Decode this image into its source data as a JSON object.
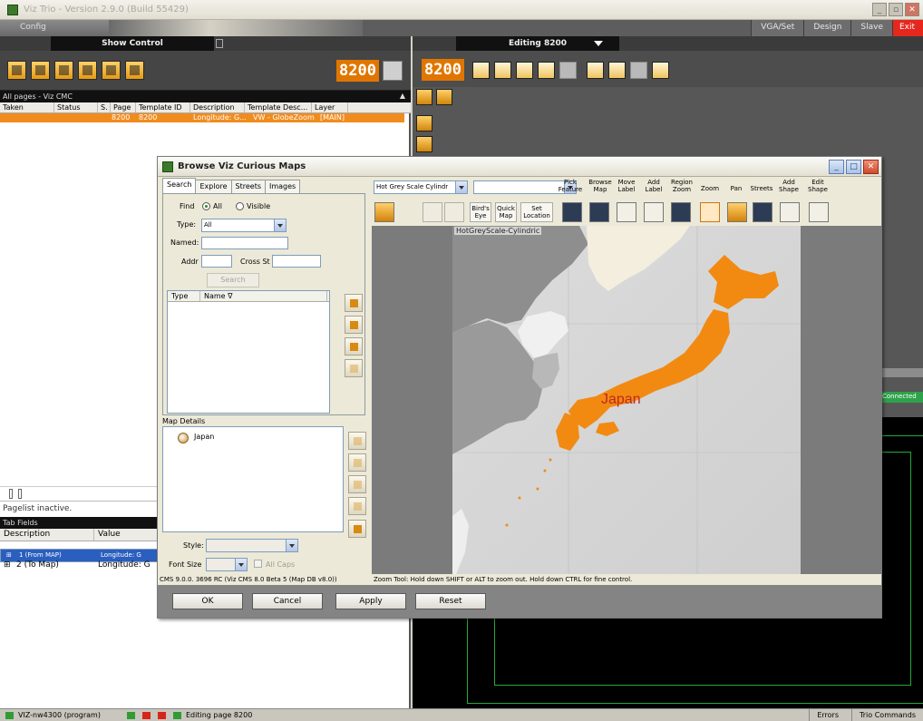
{
  "window": {
    "title": "Viz Trio - Version 2.9.0 (Build 55429)",
    "config_label": "Config",
    "right_tabs": [
      "VGA/Set",
      "Design",
      "Slave",
      "Exit"
    ]
  },
  "left_panel": {
    "header": "Show Control",
    "page_number": "8200",
    "pages_bar": "All pages - Viz CMC",
    "columns": [
      "Taken",
      "Status",
      "S.",
      "Page",
      "Template ID",
      "Description",
      "Template Desc...",
      "Layer"
    ],
    "row": {
      "page": "8200",
      "template_id": "8200",
      "description": "Longitude: G...",
      "template_desc": "VW - GlobeZoom",
      "layer": "[MAIN]"
    },
    "pagelist_status": "Pagelist inactive.",
    "tab_fields_label": "Tab Fields",
    "tab_fields_columns": [
      "Description",
      "Value"
    ],
    "tab_fields_rows": [
      {
        "expander": "⊞",
        "description": "1 (From MAP)",
        "value": "Longitude: G"
      },
      {
        "expander": "⊞",
        "description": "2 (To Map)",
        "value": "Longitude: G"
      }
    ]
  },
  "right_panel": {
    "header": "Editing 8200",
    "page_number": "8200",
    "connected": "Connected"
  },
  "dialog": {
    "title": "Browse Viz Curious Maps",
    "tabs": [
      "Search",
      "Explore",
      "Streets",
      "Images"
    ],
    "find_label": "Find",
    "find_options": [
      "All",
      "Visible"
    ],
    "type_label": "Type:",
    "type_value": "All",
    "named_label": "Named:",
    "addr_label": "Addr",
    "cross_label": "Cross St",
    "search_button": "Search",
    "results_columns": [
      "Type",
      "Name ∇"
    ],
    "map_details_label": "Map Details",
    "map_details_items": [
      "Japan"
    ],
    "style_label": "Style:",
    "font_size_label": "Font Size",
    "all_caps_label": "All Caps",
    "cms_version": "CMS 9.0.0. 3696 RC (Viz CMS 8.0 Beta 5 (Map DB v8.0))",
    "map_selector": "Hot Grey Scale Cylindr",
    "toolbar_labels": {
      "birds_eye": "Bird's Eye",
      "quick_map": "Quick Map",
      "set_location": "Set Location",
      "pick_feature": "Pick Feature",
      "browse_map": "Browse Map",
      "move_label": "Move Label",
      "add_label": "Add Label",
      "region_zoom": "Region Zoom",
      "zoom": "Zoom",
      "pan": "Pan",
      "streets": "Streets",
      "add_shape": "Add Shape",
      "edit_shape": "Edit Shape"
    },
    "map_name": "HotGreyScale-Cylindric",
    "map_country_label": "Japan",
    "status_text": "Zoom Tool: Hold down SHIFT or ALT to zoom out. Hold down CTRL for fine control.",
    "buttons": {
      "ok": "OK",
      "cancel": "Cancel",
      "apply": "Apply",
      "reset": "Reset"
    }
  },
  "statusbar": {
    "machine": "VIZ-nw4300 (program)",
    "editing": "Editing page 8200",
    "errors": "Errors",
    "trio_commands": "Trio Commands"
  },
  "colors": {
    "accent": "#f08c1e",
    "japan": "#f28a12",
    "selection": "#2b5fbf",
    "connected": "#2ea24a",
    "exit": "#e5271e"
  }
}
